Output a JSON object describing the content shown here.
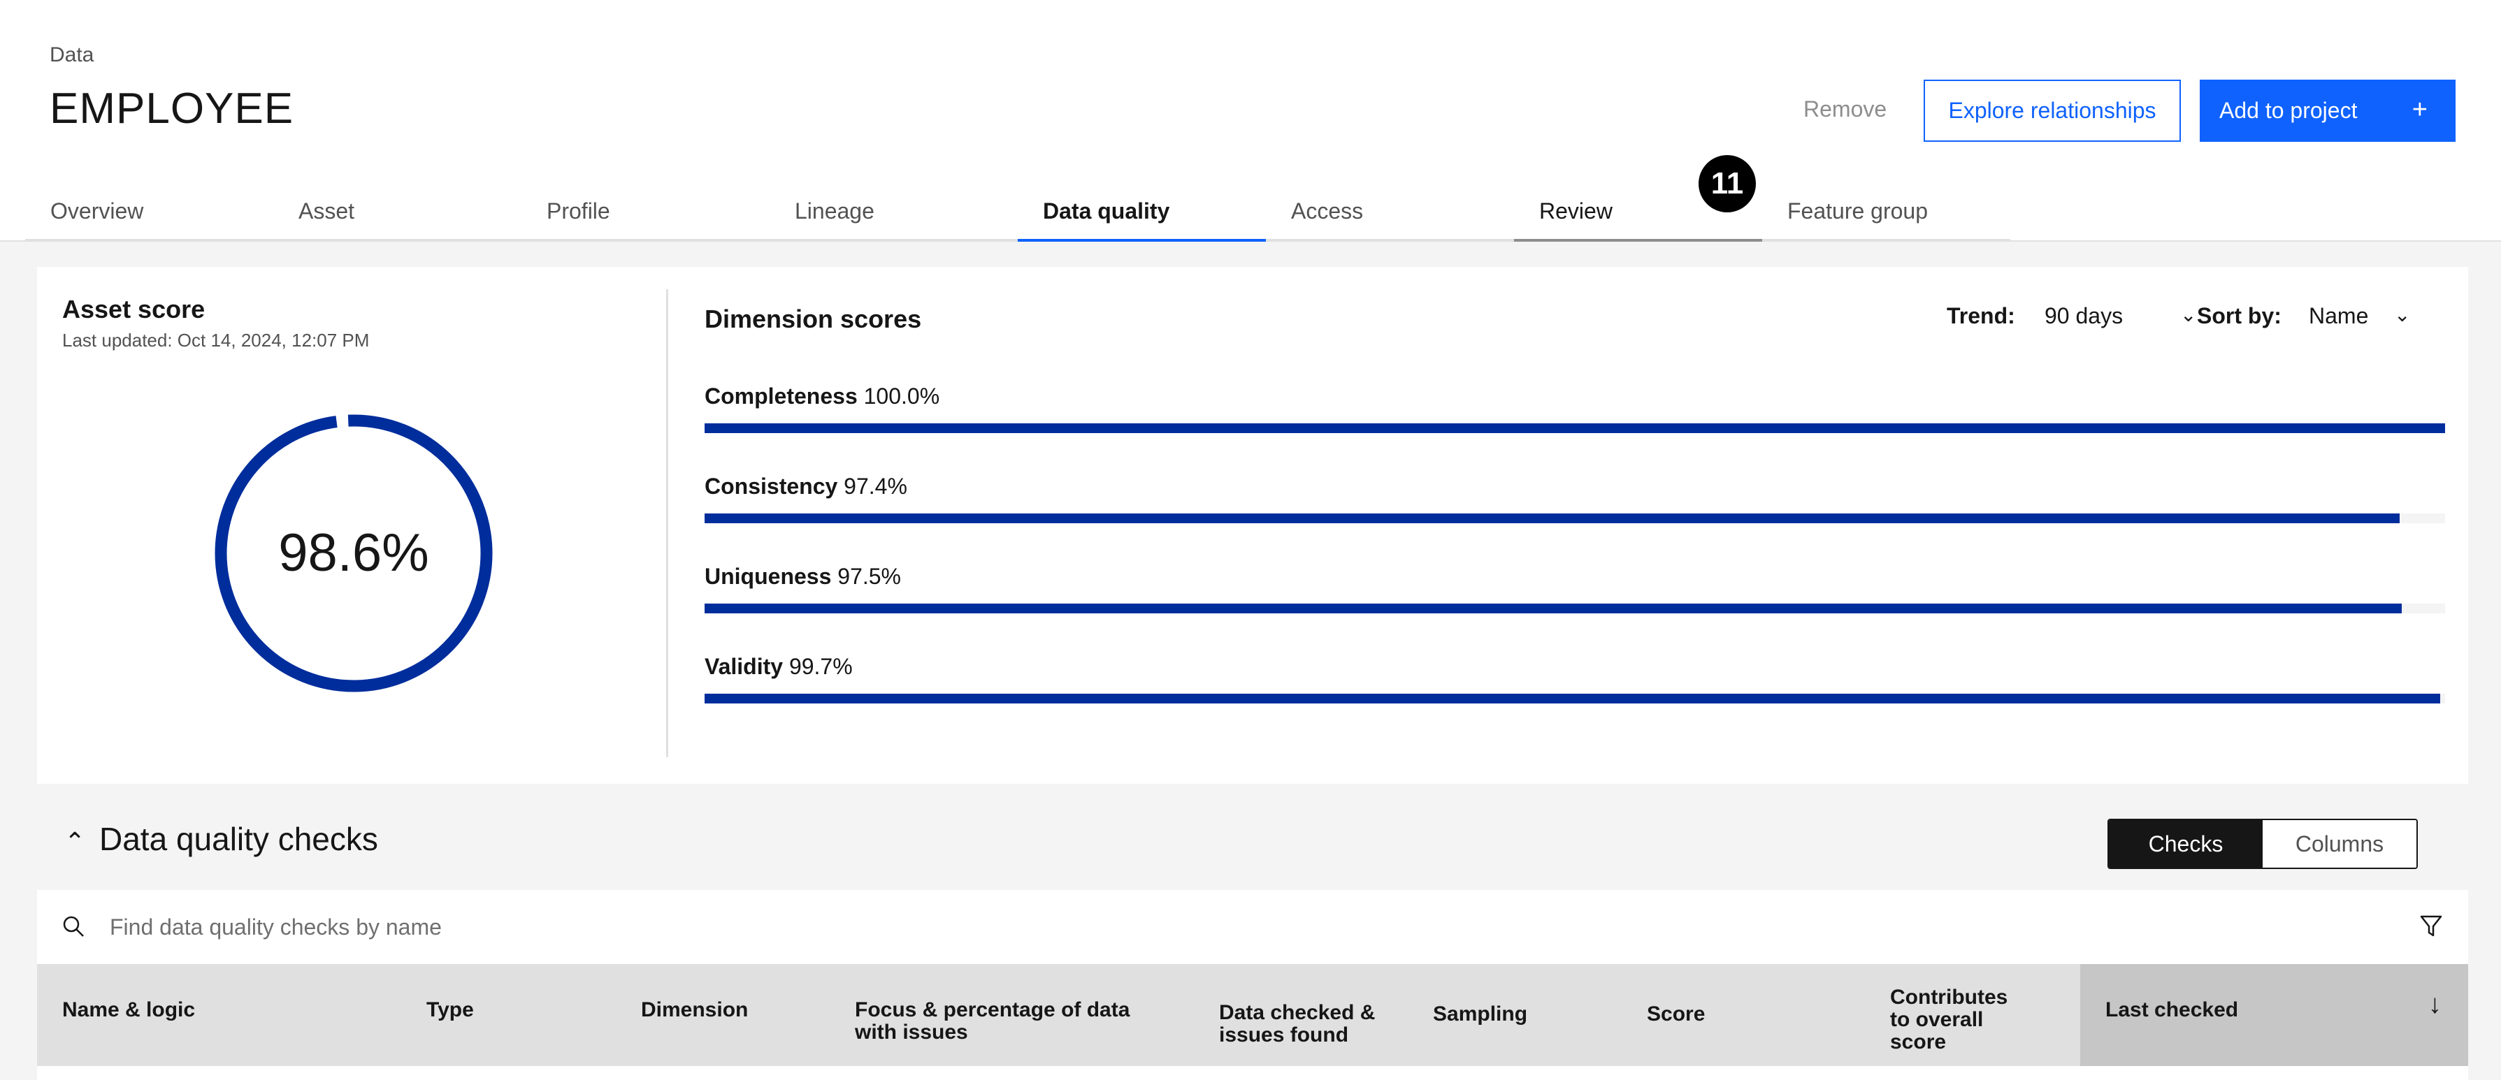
{
  "header": {
    "breadcrumb": "Data",
    "title": "EMPLOYEE",
    "actions": {
      "remove": "Remove",
      "explore": "Explore relationships",
      "add": "Add to project",
      "add_icon": "+"
    },
    "tabs": [
      "Overview",
      "Asset",
      "Profile",
      "Lineage",
      "Data quality",
      "Access",
      "Review",
      "Feature group"
    ],
    "active_tab": "Data quality",
    "badge_count": "11"
  },
  "asset_score": {
    "title": "Asset score",
    "updated": "Last updated: Oct 14, 2024, 12:07 PM",
    "value": 98.6,
    "value_label": "98.6%",
    "color": "#002d9c"
  },
  "dimensions": {
    "title": "Dimension scores",
    "trend_label": "Trend:",
    "trend_value": "90 days",
    "sort_label": "Sort by:",
    "sort_value": "Name",
    "items": [
      {
        "name": "Completeness",
        "value_label": "100.0%",
        "value": 100.0
      },
      {
        "name": "Consistency",
        "value_label": "97.4%",
        "value": 97.4
      },
      {
        "name": "Uniqueness",
        "value_label": "97.5%",
        "value": 97.5
      },
      {
        "name": "Validity",
        "value_label": "99.7%",
        "value": 99.7
      }
    ]
  },
  "checks": {
    "title": "Data quality checks",
    "toggle": {
      "checks": "Checks",
      "columns": "Columns",
      "selected": "Checks"
    },
    "search_placeholder": "Find data quality checks by name",
    "columns": {
      "name": "Name & logic",
      "type": "Type",
      "dimension": "Dimension",
      "focus_1": "Focus & percentage of data",
      "focus_2": "with issues",
      "checked_1": "Data checked &",
      "checked_2": "issues found",
      "sampling": "Sampling",
      "score": "Score",
      "contrib_1": "Contributes",
      "contrib_2": "to overall",
      "contrib_3": "score",
      "last_checked": "Last checked"
    }
  },
  "colors": {
    "primary": "#0f62fe",
    "bar": "#002d9c",
    "background": "#f4f4f4"
  }
}
